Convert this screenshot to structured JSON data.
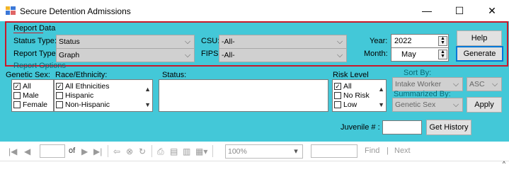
{
  "window": {
    "title": "Secure Detention Admissions",
    "min_glyph": "—",
    "max_glyph": "☐",
    "close_glyph": "✕"
  },
  "report_data": {
    "group_label": "Report Data",
    "status_type_label": "Status Type:",
    "status_type_value": "Status",
    "report_type_label": "Report Type:",
    "report_type_value": "Graph",
    "csu_label": "CSU:",
    "csu_value": "-All-",
    "fips_label": "FIPS:",
    "fips_value": "-All-",
    "year_label": "Year:",
    "year_value": "2022",
    "month_label": "Month:",
    "month_value": "May",
    "help_label": "Help",
    "generate_label": "Generate"
  },
  "report_options": {
    "group_label": "Report Options",
    "genetic_sex_label": "Genetic Sex:",
    "genetic_sex_items": [
      {
        "label": "All",
        "checked": true
      },
      {
        "label": "Male",
        "checked": false
      },
      {
        "label": "Female",
        "checked": false
      }
    ],
    "race_label": "Race/Ethnicity:",
    "race_items": [
      {
        "label": "All Ethnicities",
        "checked": true
      },
      {
        "label": "Hispanic",
        "checked": false
      },
      {
        "label": "Non-Hispanic",
        "checked": false
      }
    ],
    "status_label": "Status:",
    "risk_label": "Risk Level",
    "risk_items": [
      {
        "label": "All",
        "checked": true
      },
      {
        "label": "No Risk",
        "checked": false
      },
      {
        "label": "Low",
        "checked": false
      }
    ],
    "sort_by_label": "Sort By:",
    "sort_by_value": "Intake Worker",
    "sort_order_value": "ASC",
    "summarized_by_label": "Summarized By:",
    "summarized_by_value": "Genetic Sex",
    "apply_label": "Apply",
    "juvenile_label": "Juvenile # :",
    "juvenile_value": "",
    "get_history_label": "Get History"
  },
  "toolbar": {
    "page_of_label": "of",
    "page_value": "",
    "zoom_value": "100%",
    "find_value": "",
    "find_label": "Find",
    "find_sep": "|",
    "next_label": "Next"
  }
}
